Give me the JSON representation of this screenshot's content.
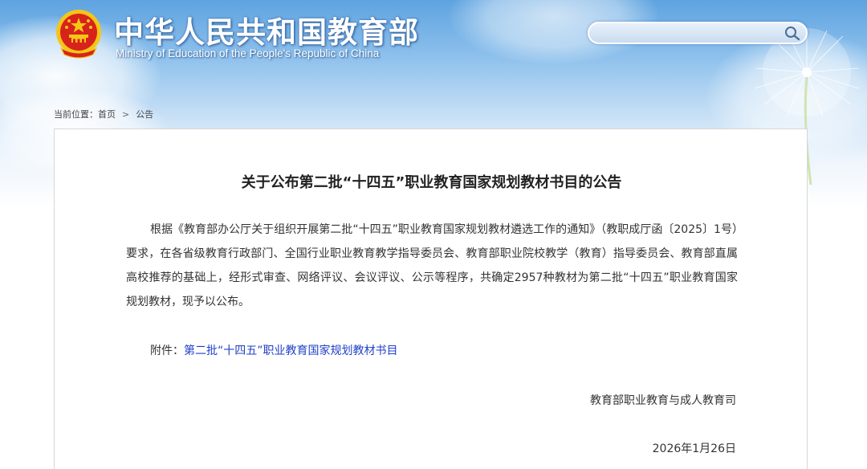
{
  "header": {
    "title_cn": "中华人民共和国教育部",
    "title_en": "Ministry of Education of the People's Republic of China",
    "emblem_icon": "national-emblem-icon",
    "search": {
      "value": "",
      "placeholder": "",
      "button_icon": "search-icon"
    }
  },
  "breadcrumb": {
    "prefix": "当前位置：",
    "items": [
      "首页",
      "公告"
    ],
    "separator": ">"
  },
  "article": {
    "title": "关于公布第二批“十四五”职业教育国家规划教材书目的公告",
    "body": "根据《教育部办公厅关于组织开展第二批“十四五”职业教育国家规划教材遴选工作的通知》（教职成厅函〔2025〕1号）要求，在各省级教育行政部门、全国行业职业教育教学指导委员会、教育部职业院校教学（教育）指导委员会、教育部直属高校推荐的基础上，经形式审查、网络评议、会议评议、公示等程序，共确定2957种教材为第二批“十四五”职业教育国家规划教材，现予以公布。",
    "attachment_label": "附件：",
    "attachment_link": "第二批“十四五”职业教育国家规划教材书目",
    "signature": "教育部职业教育与成人教育司",
    "date": "2026年1月26日"
  },
  "colors": {
    "link": "#1f3fc9",
    "sky_top": "#5ea3e0",
    "emblem_red": "#d8231c",
    "emblem_gold": "#f5c518"
  }
}
